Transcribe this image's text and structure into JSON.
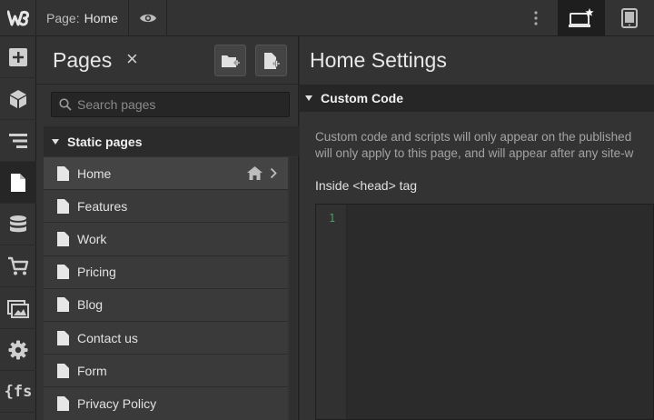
{
  "app": {
    "logo_letter": "W"
  },
  "topbar": {
    "page_prefix": "Page:",
    "page_name": "Home",
    "icons": [
      "eye-icon",
      "kebab-icon",
      "desktop-device-icon",
      "tablet-device-icon"
    ]
  },
  "rail": {
    "items": [
      {
        "name": "add-panel",
        "icon": "plus-square-icon"
      },
      {
        "name": "symbols",
        "icon": "cube-icon"
      },
      {
        "name": "navigator",
        "icon": "layers-icon"
      },
      {
        "name": "pages",
        "icon": "page-icon",
        "active": true
      },
      {
        "name": "cms",
        "icon": "database-icon"
      },
      {
        "name": "ecommerce",
        "icon": "cart-icon"
      },
      {
        "name": "assets",
        "icon": "images-icon"
      },
      {
        "name": "settings",
        "icon": "gear-icon"
      },
      {
        "name": "finsweet",
        "icon": "fs-icon"
      }
    ],
    "fs_label": "{fs"
  },
  "pages_panel": {
    "title": "Pages",
    "close_glyph": "×",
    "search_placeholder": "Search pages",
    "section_label": "Static pages",
    "pages": [
      {
        "label": "Home",
        "selected": true
      },
      {
        "label": "Features"
      },
      {
        "label": "Work"
      },
      {
        "label": "Pricing"
      },
      {
        "label": "Blog"
      },
      {
        "label": "Contact us"
      },
      {
        "label": "Form"
      },
      {
        "label": "Privacy Policy"
      }
    ]
  },
  "settings": {
    "title": "Home Settings",
    "section_label": "Custom Code",
    "description_line1": "Custom code and scripts will only appear on the published",
    "description_line2": "will only apply to this page, and will appear after any site-w",
    "head_label": "Inside <head> tag",
    "editor_line": "1"
  },
  "colors": {
    "panel_bg": "#333333",
    "dark_bg": "#262626",
    "line_number": "#4e9a66",
    "text": "#e0e0e0"
  }
}
